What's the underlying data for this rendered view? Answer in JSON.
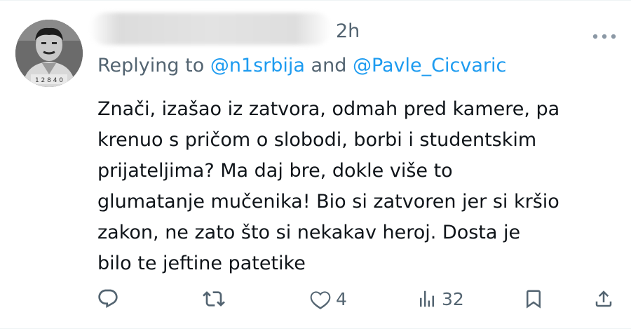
{
  "tweet": {
    "time": "2h",
    "reply_prefix": "Replying to ",
    "mention_1": "@n1srbija",
    "reply_and": " and ",
    "mention_2": "@Pavle_Cicvaric",
    "text_lines": [
      "Znači, izašao iz zatvora, odmah pred kamere, pa",
      "krenuo s pričom o slobodi, borbi i studentskim",
      "prijateljima? Ma daj bre, dokle više to",
      "glumatanje mučenika! Bio si zatvoren jer si kršio",
      "zakon, ne zato što si nekakav heroj. Dosta je",
      "bilo te jeftine patetike"
    ]
  },
  "actions": {
    "reply_icon": "reply-icon",
    "retweet_icon": "retweet-icon",
    "like_icon": "heart-icon",
    "like_count": "4",
    "views_icon": "views-icon",
    "views_count": "32",
    "bookmark_icon": "bookmark-icon",
    "share_icon": "share-icon"
  },
  "colors": {
    "text": "#0f1419",
    "secondary": "#536471",
    "link": "#1d9bf0"
  }
}
